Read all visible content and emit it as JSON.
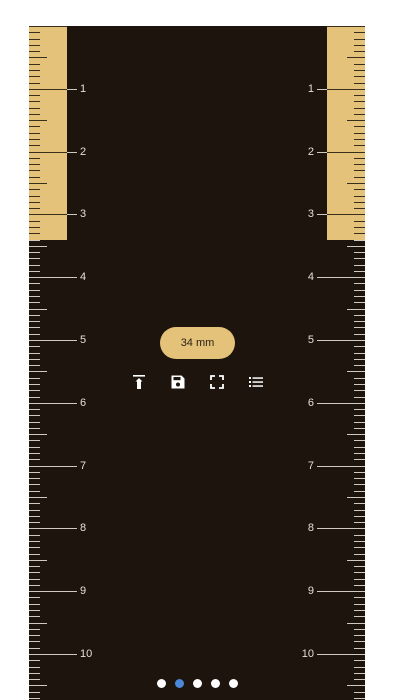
{
  "ruler": {
    "unit": "cm",
    "labels": [
      "1",
      "2",
      "3",
      "4",
      "5",
      "6",
      "7",
      "8",
      "9",
      "10"
    ]
  },
  "measurement": {
    "label": "34 mm",
    "value_mm": 34
  },
  "toolbar": {
    "icons": [
      "align-top-icon",
      "save-icon",
      "fullscreen-icon",
      "list-icon"
    ]
  },
  "pager": {
    "count": 5,
    "active_index": 1
  },
  "colors": {
    "background": "#1c140d",
    "ruler_highlight": "#e5c27a",
    "tick_light": "#cfcac0",
    "tick_dark": "#3a2e1c",
    "pill": "#e5c27a",
    "active_dot": "#4b88d8"
  }
}
